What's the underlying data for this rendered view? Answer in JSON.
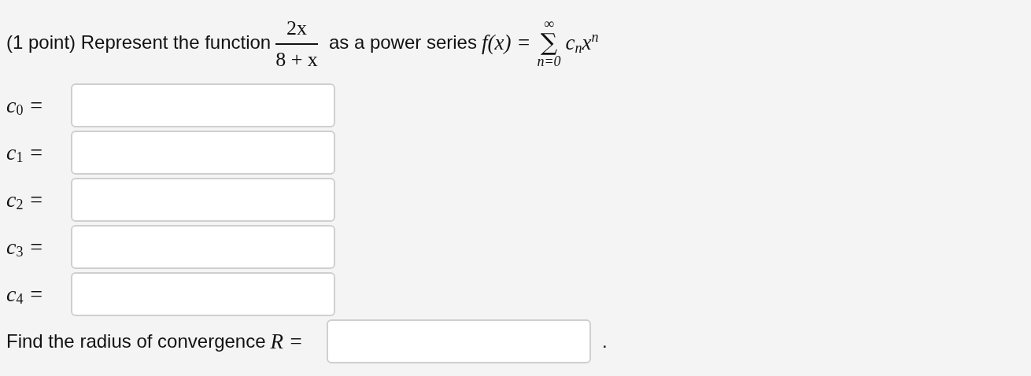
{
  "question": {
    "intro": "(1 point) Represent the function",
    "fraction": {
      "numerator": "2x",
      "denominator": "8 + x"
    },
    "middle": "as a power series",
    "lhs": "f(x) =",
    "sum": {
      "upper": "∞",
      "symbol": "∑",
      "lower": "n=0",
      "term": "c$_{n}$x$^{n}$"
    }
  },
  "coefficients": [
    {
      "label": "c$_{0}$ ="
    },
    {
      "label": "c$_{1}$ ="
    },
    {
      "label": "c$_{2}$ ="
    },
    {
      "label": "c$_{3}$ ="
    },
    {
      "label": "c$_{4}$ ="
    }
  ],
  "radius": {
    "text": "Find the radius of convergence",
    "math": "R =",
    "after": "."
  }
}
